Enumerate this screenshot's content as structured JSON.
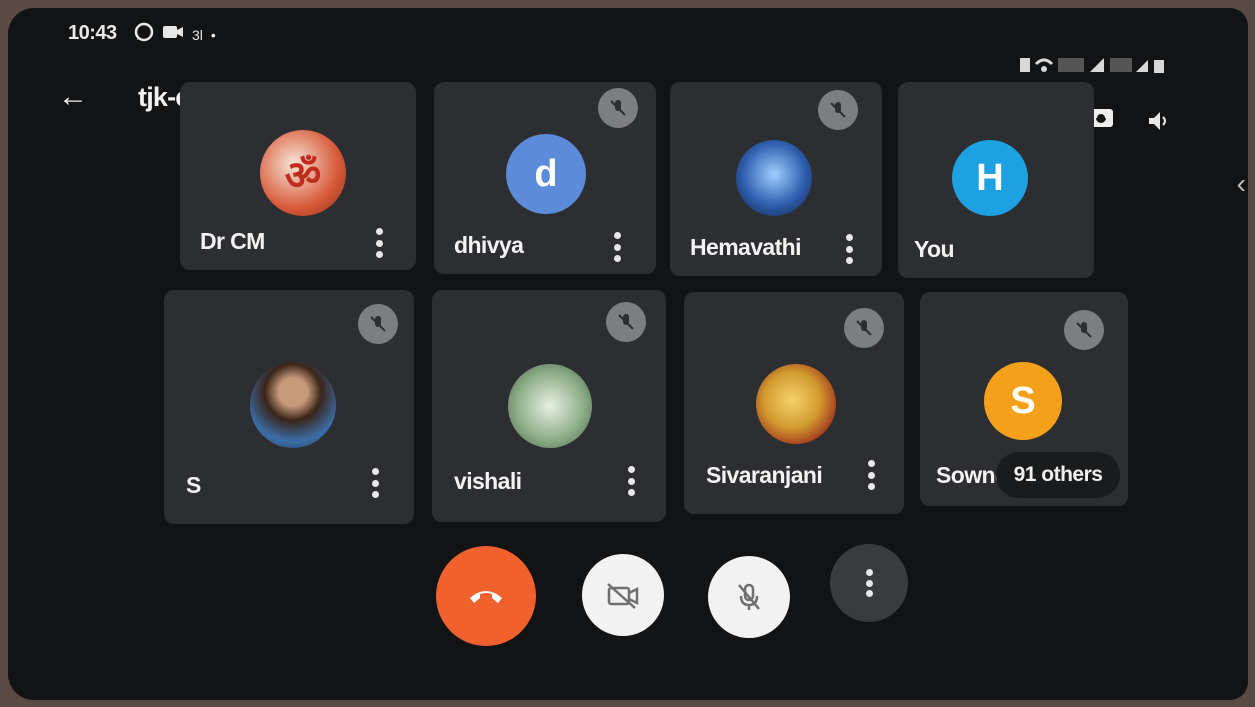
{
  "status_bar": {
    "time": "10:43",
    "left_icons": [
      "whatsapp-icon",
      "video-icon",
      "network-icon",
      "dot-icon"
    ],
    "right_icons": [
      "vibrate-icon",
      "wifi-icon",
      "volte-icon",
      "signal-icon",
      "battery-icon"
    ]
  },
  "header": {
    "meeting_code": "tjk-empm-xxs",
    "back_icon": "back-arrow-icon",
    "speaker_indicator": "audio-level-icon",
    "right_icons": [
      "mic-off-icon",
      "switch-camera-icon",
      "speaker-icon"
    ]
  },
  "participants": [
    {
      "name": "Dr CM",
      "avatar_type": "image",
      "avatar_color": "#d85a3a",
      "muted": false
    },
    {
      "name": "dhivya",
      "avatar_type": "initial",
      "initial": "d",
      "avatar_color": "#5b8bd9",
      "muted": true
    },
    {
      "name": "Hemavathi",
      "avatar_type": "image",
      "avatar_color": "#2f5fae",
      "muted": true
    },
    {
      "name": "You",
      "avatar_type": "initial",
      "initial": "H",
      "avatar_color": "#1da1e0",
      "muted": true
    },
    {
      "name": "S",
      "avatar_type": "image",
      "avatar_color": "#3b6ea8",
      "muted": true
    },
    {
      "name": "vishali",
      "avatar_type": "image",
      "avatar_color": "#8fb08a",
      "muted": true
    },
    {
      "name": "Sivaranjani",
      "avatar_type": "image",
      "avatar_color": "#d19b2f",
      "muted": true
    },
    {
      "name": "Sowndarya",
      "avatar_type": "initial",
      "initial": "S",
      "avatar_color": "#f5a01a",
      "muted": true
    }
  ],
  "others_label": "91 others",
  "controls": {
    "end_call": {
      "icon": "end-call-icon",
      "color": "#f0612e"
    },
    "camera": {
      "icon": "camera-off-icon",
      "color": "#f2f2f2"
    },
    "mic": {
      "icon": "mic-off-icon",
      "color": "#f2f2f2"
    },
    "more": {
      "icon": "more-vert-icon",
      "color": "#3a3b3e"
    }
  }
}
